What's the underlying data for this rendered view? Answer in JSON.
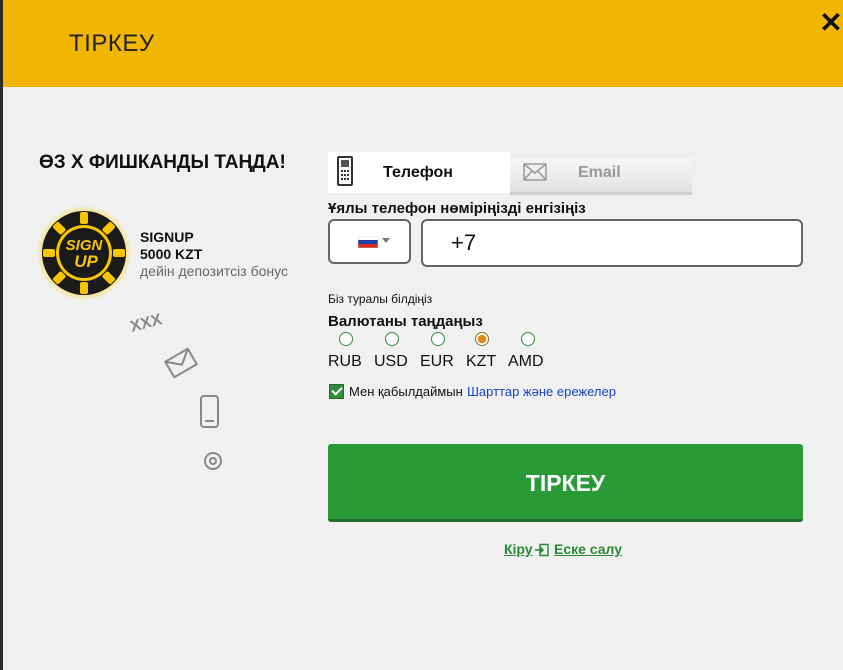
{
  "header": {
    "title": "ТІРКЕУ",
    "close_label": "✕"
  },
  "promo": {
    "title": "ӨЗ Х ФИШКАНДЫ ТАҢДА!",
    "chip_text_line1": "SIGN",
    "chip_text_line2": "UP",
    "bonus_code": "SIGNUP",
    "bonus_amount": "5000 KZT",
    "bonus_desc": "дейін депозитсіз бонус",
    "deco_text": "XXX"
  },
  "tabs": [
    {
      "label": "Телефон",
      "icon": "mobile-phone-icon",
      "active": true
    },
    {
      "label": "Email",
      "icon": "envelope-icon",
      "active": false
    }
  ],
  "phone": {
    "label": "Ұялы телефон нөміріңізді енгізіңіз",
    "value": "+7",
    "country_flag": "russia-flag"
  },
  "about_us": "Біз туралы білдіңіз",
  "currency": {
    "label": "Валютаны таңдаңыз",
    "options": [
      "RUB",
      "USD",
      "EUR",
      "KZT",
      "AMD"
    ],
    "selected": "KZT"
  },
  "terms": {
    "accept_text": "Мен қабылдаймын",
    "link_text": "Шарттар және ережелер",
    "checked": true
  },
  "register_button": "ТІРКЕУ",
  "login_link": "Кіру",
  "remember_link": "Еске салу",
  "colors": {
    "header": "#f2b600",
    "primary": "#2a9a36",
    "link": "#1a44c4"
  }
}
